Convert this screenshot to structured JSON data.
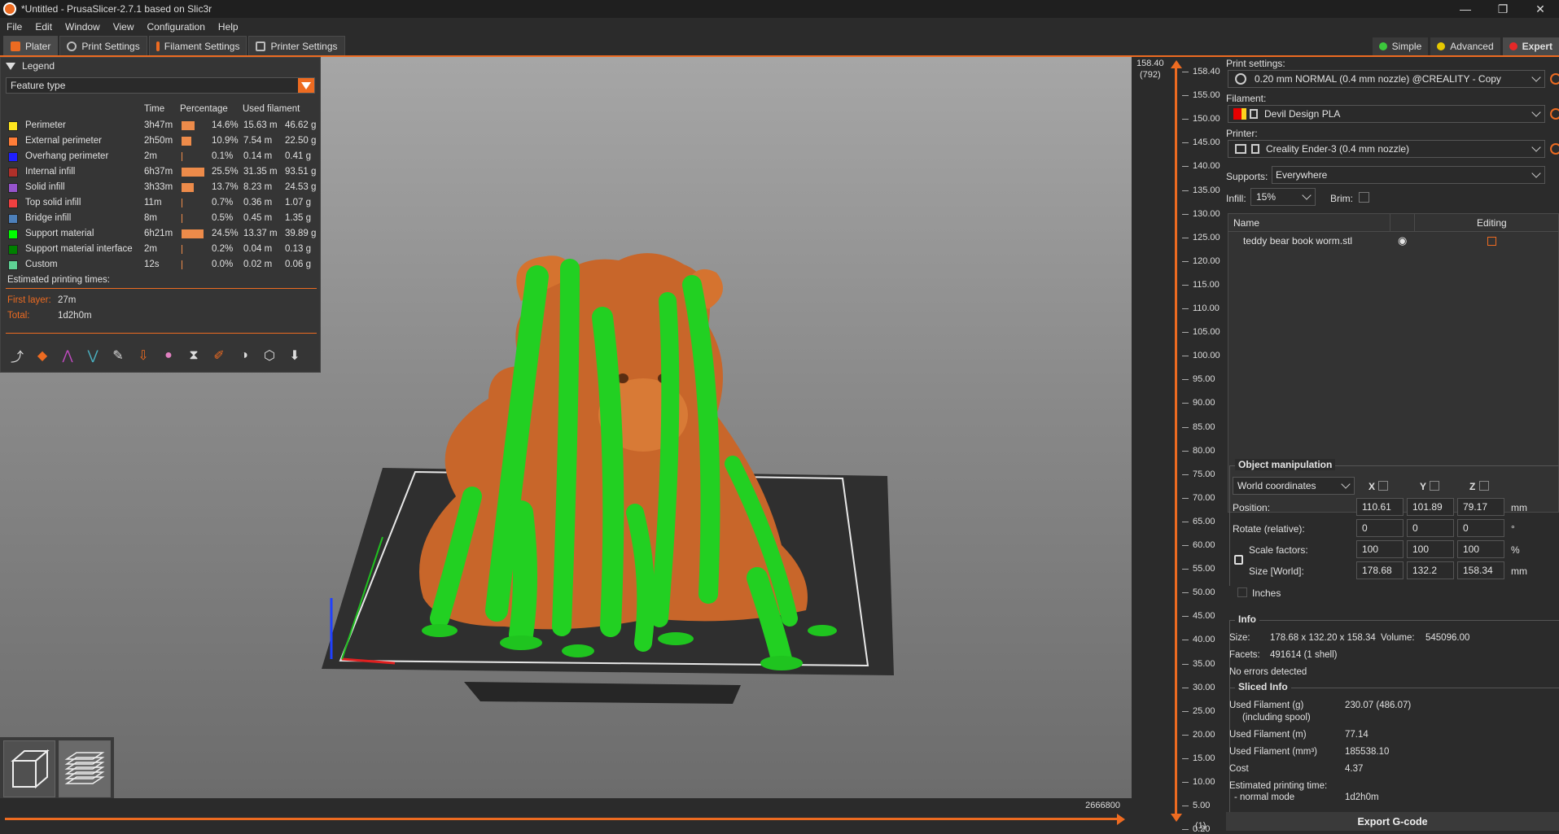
{
  "window": {
    "title": "*Untitled - PrusaSlicer-2.7.1 based on Slic3r"
  },
  "menu": [
    "File",
    "Edit",
    "Window",
    "View",
    "Configuration",
    "Help"
  ],
  "tabs": [
    {
      "label": "Plater"
    },
    {
      "label": "Print Settings"
    },
    {
      "label": "Filament Settings"
    },
    {
      "label": "Printer Settings"
    }
  ],
  "modes": [
    {
      "label": "Simple",
      "color": "#3cc83c"
    },
    {
      "label": "Advanced",
      "color": "#e6c800"
    },
    {
      "label": "Expert",
      "color": "#e62828"
    }
  ],
  "legend": {
    "title": "Legend",
    "view_type": "Feature type",
    "headers": {
      "time": "Time",
      "percentage": "Percentage",
      "used": "Used filament"
    },
    "rows": [
      {
        "name": "Perimeter",
        "color": "#ffe61e",
        "time": "3h47m",
        "pct": "14.6%",
        "pct_value": 14.6,
        "len": "15.63 m",
        "weight": "46.62 g"
      },
      {
        "name": "External perimeter",
        "color": "#ff7d38",
        "time": "2h50m",
        "pct": "10.9%",
        "pct_value": 10.9,
        "len": "7.54 m",
        "weight": "22.50 g"
      },
      {
        "name": "Overhang perimeter",
        "color": "#1f1fff",
        "time": "2m",
        "pct": "0.1%",
        "pct_value": 0.1,
        "len": "0.14 m",
        "weight": "0.41 g"
      },
      {
        "name": "Internal infill",
        "color": "#b03029",
        "time": "6h37m",
        "pct": "25.5%",
        "pct_value": 25.5,
        "len": "31.35 m",
        "weight": "93.51 g"
      },
      {
        "name": "Solid infill",
        "color": "#9654cc",
        "time": "3h33m",
        "pct": "13.7%",
        "pct_value": 13.7,
        "len": "8.23 m",
        "weight": "24.53 g"
      },
      {
        "name": "Top solid infill",
        "color": "#f04040",
        "time": "11m",
        "pct": "0.7%",
        "pct_value": 0.7,
        "len": "0.36 m",
        "weight": "1.07 g"
      },
      {
        "name": "Bridge infill",
        "color": "#4d80ba",
        "time": "8m",
        "pct": "0.5%",
        "pct_value": 0.5,
        "len": "0.45 m",
        "weight": "1.35 g"
      },
      {
        "name": "Support material",
        "color": "#00ff00",
        "time": "6h21m",
        "pct": "24.5%",
        "pct_value": 24.5,
        "len": "13.37 m",
        "weight": "39.89 g"
      },
      {
        "name": "Support material interface",
        "color": "#008000",
        "time": "2m",
        "pct": "0.2%",
        "pct_value": 0.2,
        "len": "0.04 m",
        "weight": "0.13 g"
      },
      {
        "name": "Custom",
        "color": "#5ed194",
        "time": "12s",
        "pct": "0.0%",
        "pct_value": 0.0,
        "len": "0.02 m",
        "weight": "0.06 g"
      }
    ],
    "est_title": "Estimated printing times:",
    "first_layer_label": "First layer:",
    "first_layer": "27m",
    "total_label": "Total:",
    "total": "1d2h0m"
  },
  "vslider": {
    "top_value": "158.40",
    "top_layer": "(792)",
    "bottom_value": "0.20",
    "bottom_layer": "(1)",
    "ticks": [
      "158.40",
      "155.00",
      "150.00",
      "145.00",
      "140.00",
      "135.00",
      "130.00",
      "125.00",
      "120.00",
      "115.00",
      "110.00",
      "105.00",
      "100.00",
      "95.00",
      "90.00",
      "85.00",
      "80.00",
      "75.00",
      "70.00",
      "65.00",
      "60.00",
      "55.00",
      "50.00",
      "45.00",
      "40.00",
      "35.00",
      "30.00",
      "25.00",
      "20.00",
      "15.00",
      "10.00",
      "5.00",
      "0.20"
    ]
  },
  "hslider": {
    "value": "2666800"
  },
  "sidebar": {
    "print_settings_label": "Print settings:",
    "print_profile": "0.20 mm NORMAL (0.4 mm nozzle) @CREALITY - Copy",
    "filament_label": "Filament:",
    "filament": "Devil Design PLA",
    "filament_colors": [
      "#e60000",
      "#ffd21e"
    ],
    "printer_label": "Printer:",
    "printer": "Creality Ender-3 (0.4 mm nozzle)",
    "supports_label": "Supports:",
    "supports": "Everywhere",
    "infill_label": "Infill:",
    "infill": "15%",
    "brim_label": "Brim:",
    "objects": {
      "name_header": "Name",
      "editing_header": "Editing",
      "items": [
        {
          "name": "teddy bear book worm.stl"
        }
      ]
    },
    "manipulation": {
      "title": "Object manipulation",
      "coords": "World coordinates",
      "x": "X",
      "y": "Y",
      "z": "Z",
      "position_label": "Position:",
      "position": [
        "110.61",
        "101.89",
        "79.17"
      ],
      "position_unit": "mm",
      "rotate_label": "Rotate (relative):",
      "rotate": [
        "0",
        "0",
        "0"
      ],
      "rotate_unit": "°",
      "scale_label": "Scale factors:",
      "scale": [
        "100",
        "100",
        "100"
      ],
      "scale_unit": "%",
      "size_label": "Size [World]:",
      "size": [
        "178.68",
        "132.2",
        "158.34"
      ],
      "size_unit": "mm",
      "inches_label": "Inches"
    },
    "info": {
      "title": "Info",
      "size_label": "Size:",
      "size": "178.68 x 132.20 x 158.34",
      "volume_label": "Volume:",
      "volume": "545096.00",
      "facets_label": "Facets:",
      "facets": "491614 (1 shell)",
      "errors": "No errors detected"
    },
    "sliced": {
      "title": "Sliced Info",
      "rows": [
        {
          "label": "Used Filament (g)",
          "sub": "(including spool)",
          "value": "230.07 (486.07)"
        },
        {
          "label": "Used Filament (m)",
          "value": "77.14"
        },
        {
          "label": "Used Filament (mm³)",
          "value": "185538.10"
        },
        {
          "label": "Cost",
          "value": "4.37"
        },
        {
          "label": "Estimated printing time:",
          "sub": "- normal mode",
          "value": "1d2h0m"
        }
      ]
    },
    "export_label": "Export G-code"
  }
}
